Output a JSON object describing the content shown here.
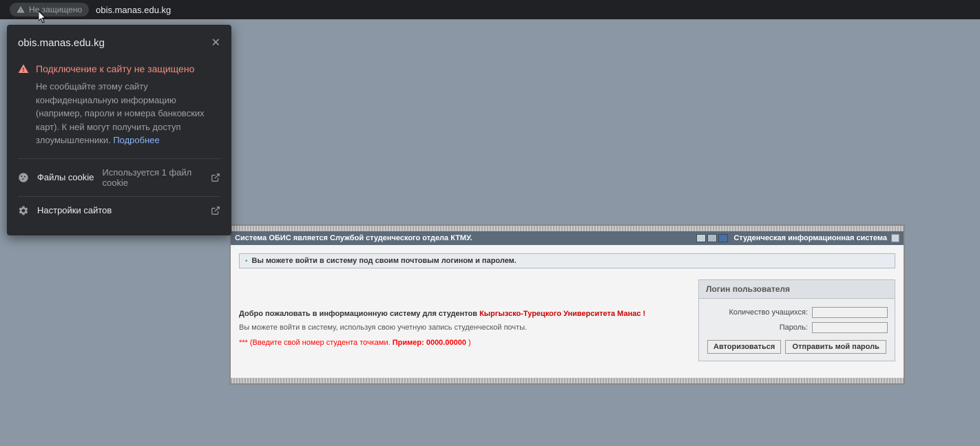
{
  "browser": {
    "not_secure_label": "Не защищено",
    "url": "obis.manas.edu.kg"
  },
  "popup": {
    "domain": "obis.manas.edu.kg",
    "warning_title": "Подключение к сайту не защищено",
    "warning_body": "Не сообщайте этому сайту конфиденциальную информацию (например, пароли и номера банковских карт). К ней могут получить доступ злоумышленники. ",
    "learn_more": "Подробнее",
    "cookies_label": "Файлы cookie",
    "cookies_detail": "Используется 1 файл cookie",
    "site_settings_label": "Настройки сайтов"
  },
  "page": {
    "title_left": "Система ОБИС является Службой студенческого отдела КТМУ.",
    "title_right": "Студенческая информационная система",
    "hint": "Вы можете войти в систему под своим почтовым логином и паролем.",
    "welcome_prefix": "Добро пожаловать в информационную систему для студентов ",
    "welcome_university": "Кыргызско-Турецкого Университета Манас !",
    "welcome_line2": "Вы можете войти в систему, используя свою учетную запись студенческой почты.",
    "welcome_line3_prefix": "*** (Введите свой номер студента точками. ",
    "welcome_line3_example": "Пример: 0000.00000",
    "welcome_line3_suffix": " )",
    "login": {
      "panel_title": "Логин пользователя",
      "field1_label": "Количество учащихся:",
      "field2_label": "Пароль:",
      "button_login": "Авторизоваться",
      "button_send": "Отправить мой пароль"
    }
  }
}
